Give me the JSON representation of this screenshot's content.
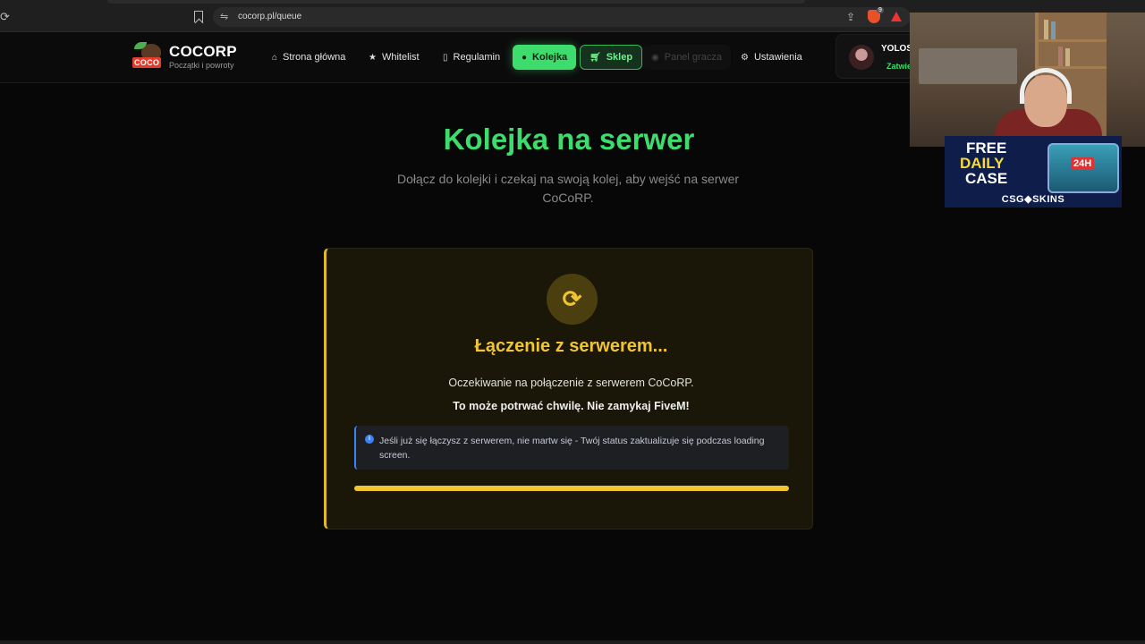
{
  "browser": {
    "url": "cocorp.pl/queue",
    "extension_badge": "9"
  },
  "brand": {
    "logo_text": "COCO",
    "name": "COCORP",
    "tagline": "Początki i powroty"
  },
  "nav": {
    "items": [
      {
        "label": "Strona główna",
        "icon": "home-icon"
      },
      {
        "label": "Whitelist",
        "icon": "star-icon"
      },
      {
        "label": "Regulamin",
        "icon": "document-icon"
      },
      {
        "label": "Kolejka",
        "icon": "user-icon",
        "active": true
      },
      {
        "label": "Sklep",
        "icon": "cart-icon"
      },
      {
        "label": "Panel gracza",
        "icon": "gamepad-icon",
        "disabled": true
      },
      {
        "label": "Ustawienia",
        "icon": "gear-icon"
      }
    ]
  },
  "user": {
    "name": "YOLOS",
    "status": "Zatwie"
  },
  "main": {
    "title": "Kolejka na serwer",
    "subtitle": "Dołącz do kolejki i czekaj na swoją kolej, aby wejść na serwer CoCoRP."
  },
  "card": {
    "icon": "sync-icon",
    "title": "Łączenie z serwerem...",
    "text": "Oczekiwanie na połączenie z serwerem CoCoRP.",
    "warning": "To może potrwać chwilę. Nie zamykaj FiveM!",
    "info": "Jeśli już się łączysz z serwerem, nie martw się - Twój status zaktualizuje się podczas loading screen.",
    "progress_fraction": 1.0
  },
  "ad": {
    "line1": "FREE",
    "line2": "DAILY",
    "line3": "CASE",
    "chest_tag": "24H",
    "brand": "CSG◆SKINS"
  },
  "colors": {
    "accent_green": "#3ddc6d",
    "accent_yellow": "#f0c531",
    "info_blue": "#3b82f6"
  }
}
